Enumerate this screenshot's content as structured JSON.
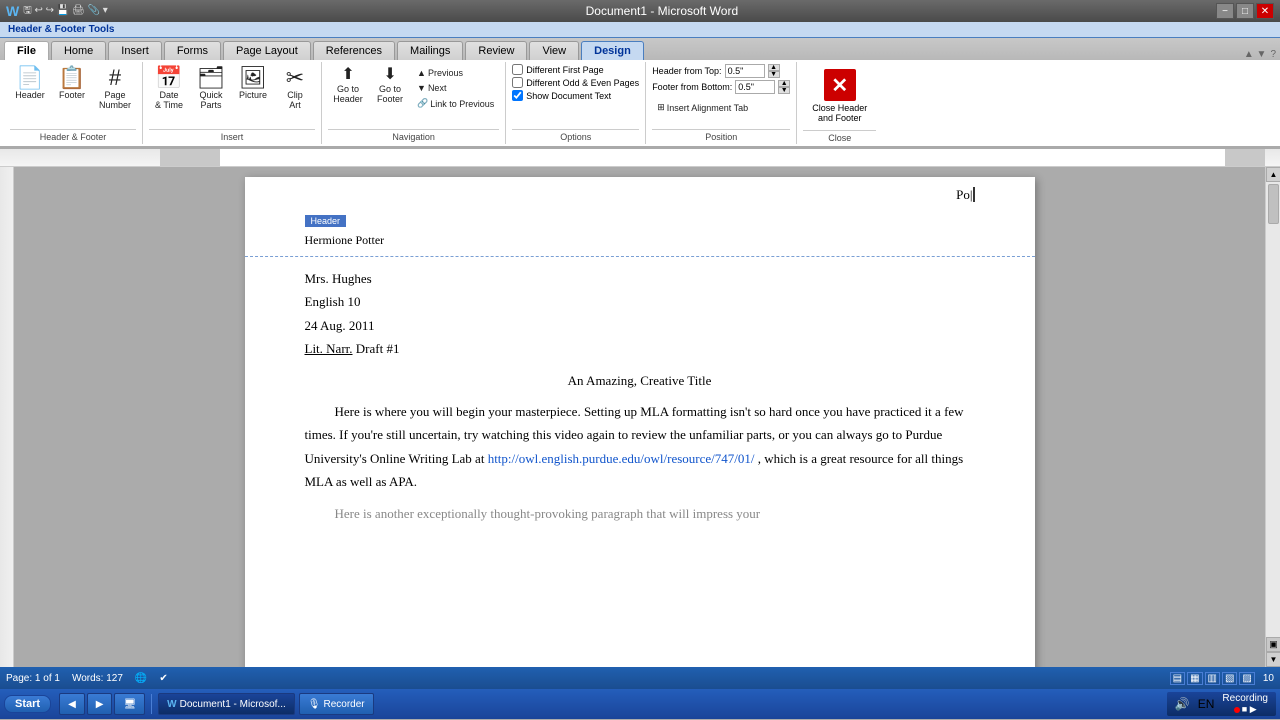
{
  "titlebar": {
    "title": "Document1 - Microsoft Word",
    "word_icon": "W",
    "min_label": "−",
    "restore_label": "□",
    "close_label": "✕"
  },
  "header_footer_tools": {
    "label": "Header & Footer Tools"
  },
  "tabs": [
    {
      "id": "file",
      "label": "File"
    },
    {
      "id": "home",
      "label": "Home"
    },
    {
      "id": "insert",
      "label": "Insert"
    },
    {
      "id": "forms",
      "label": "Forms"
    },
    {
      "id": "page_layout",
      "label": "Page Layout"
    },
    {
      "id": "references",
      "label": "References"
    },
    {
      "id": "mailings",
      "label": "Mailings"
    },
    {
      "id": "review",
      "label": "Review"
    },
    {
      "id": "view",
      "label": "View"
    },
    {
      "id": "design",
      "label": "Design"
    }
  ],
  "ribbon": {
    "groups": {
      "header_footer": {
        "label": "Header & Footer",
        "header_btn": "Header",
        "footer_btn": "Footer",
        "page_number_btn": "Page\nNumber"
      },
      "insert": {
        "label": "Insert",
        "date_time_btn": "Date\n& Time",
        "quick_parts_btn": "Quick\nParts",
        "picture_btn": "Picture",
        "clip_art_btn": "Clip\nArt"
      },
      "navigation": {
        "label": "Navigation",
        "previous_btn": "Previous",
        "next_btn": "Next",
        "link_to_prev_btn": "Link to Previous",
        "goto_header_btn": "Go to\nHeader",
        "goto_footer_btn": "Go to\nFooter"
      },
      "options": {
        "label": "Options",
        "different_first": "Different First Page",
        "different_odd_even": "Different Odd & Even Pages",
        "show_doc_text": "Show Document Text"
      },
      "position": {
        "label": "Position",
        "header_from_top_label": "Header from Top:",
        "header_from_top_value": "0.5\"",
        "footer_from_bottom_label": "Footer from Bottom:",
        "footer_from_bottom_value": "0.5\"",
        "insert_alignment_btn": "Insert Alignment Tab"
      },
      "close": {
        "label": "Close",
        "close_btn": "Close Header\nand Footer"
      }
    }
  },
  "document": {
    "header_label": "Header",
    "page_number": "Po|",
    "author": "Hermione Potter",
    "teacher": "Mrs. Hughes",
    "class": "English 10",
    "date": "24 Aug. 2011",
    "assignment": "Lit. Narr. Draft #1",
    "title": "An Amazing, Creative Title",
    "paragraph1": "Here is where you will begin your masterpiece. Setting up MLA formatting isn't so hard once you have practiced it a few times. If you're still uncertain, try watching this video again to review the unfamiliar parts, or you can always go to Purdue University's Online Writing Lab at",
    "link": "http://owl.english.purdue.edu/owl/resource/747/01/",
    "paragraph1_cont": ", which is a great resource for all things MLA as well as APA.",
    "paragraph2_start": "Here is another exceptionally thought-provoking paragraph that will impress your"
  },
  "statusbar": {
    "page_info": "Page: 1 of 1",
    "word_count": "Words: 127",
    "view_icons": [
      "▤",
      "▦",
      "▥",
      "▧",
      "▨"
    ],
    "zoom": "10"
  },
  "taskbar": {
    "start_btn": "Start",
    "quick_launch": [
      "◀",
      "▶",
      "🖥"
    ],
    "open_apps": [
      {
        "label": "Document1 - Microsof...",
        "icon": "W"
      },
      {
        "label": "Recorder",
        "icon": "🎙"
      }
    ],
    "time": "Recording",
    "system_icons": [
      "🔊",
      "EN"
    ]
  },
  "recording": {
    "label": "Recording"
  }
}
